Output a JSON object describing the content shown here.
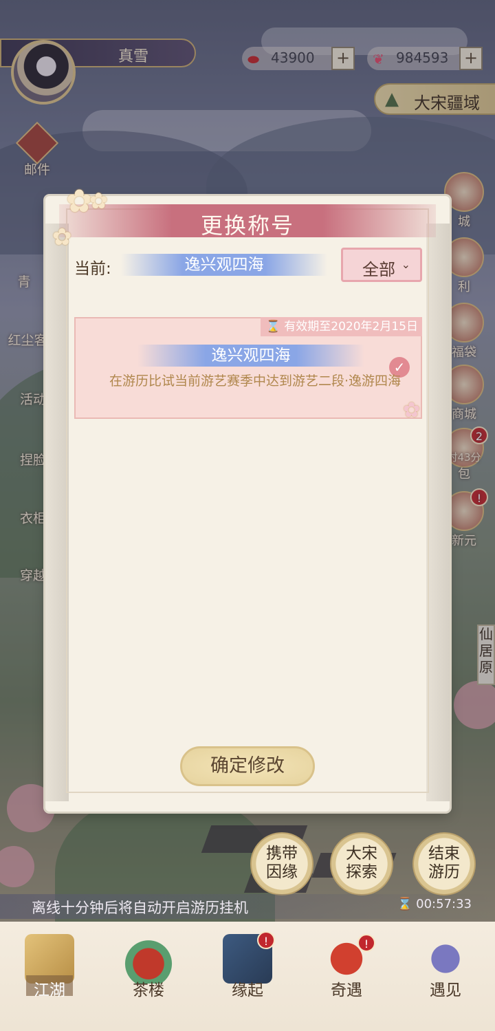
{
  "player": {
    "name": "真雪"
  },
  "resources": [
    {
      "icon": "red-bean-icon",
      "value": "43900",
      "add_label": "+"
    },
    {
      "icon": "butterfly-icon",
      "value": "984593",
      "add_label": "+"
    }
  ],
  "region": {
    "name": "大宋疆域"
  },
  "left_menu": [
    {
      "label": "邮件"
    },
    {
      "label": "青"
    },
    {
      "label": "红尘客"
    },
    {
      "label": "活动"
    },
    {
      "label": "捏脸"
    },
    {
      "label": "衣柜"
    },
    {
      "label": "穿越"
    }
  ],
  "right_menu": [
    {
      "label": "城"
    },
    {
      "label": "利"
    },
    {
      "label": "福袋"
    },
    {
      "label": "商城"
    },
    {
      "label": "包",
      "sub": "时43分",
      "badge": "2"
    },
    {
      "label": "新元",
      "badge": "!"
    }
  ],
  "xianju": {
    "label": "仙居原"
  },
  "dialog": {
    "title": "更换称号",
    "current_label": "当前:",
    "current_title": "逸兴观四海",
    "filter": {
      "selected": "全部",
      "chevron": "⌄"
    },
    "cards": [
      {
        "validity_icon": "hourglass-icon",
        "validity": "有效期至2020年2月15日",
        "title": "逸兴观四海",
        "description": "在游历比试当前游艺赛季中达到游艺二段·逸游四海",
        "selected_mark": "✓"
      }
    ],
    "confirm_label": "确定修改"
  },
  "actions": [
    {
      "label": "携带因缘"
    },
    {
      "label": "大宋探索"
    },
    {
      "label": "结束游历"
    }
  ],
  "notice": {
    "message": "离线十分钟后将自动开启游历挂机",
    "timer": "00:57:33"
  },
  "nav": [
    {
      "label": "江湖",
      "active": true
    },
    {
      "label": "茶楼"
    },
    {
      "label": "缘起",
      "badge": "!"
    },
    {
      "label": "奇遇",
      "badge": "!"
    },
    {
      "label": "遇见"
    }
  ],
  "colors": {
    "accent_pink": "#c8707e",
    "tag_blue": "#8aa6e6",
    "card_bg": "#f8dcd7",
    "gold": "#d9c28a"
  }
}
